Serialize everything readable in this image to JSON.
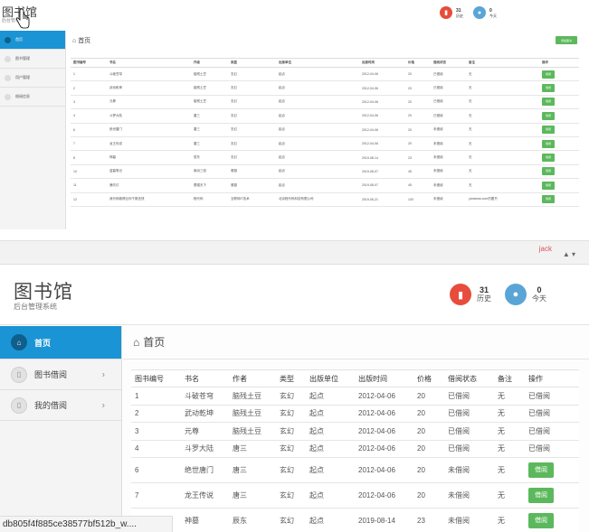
{
  "brand": {
    "title": "图书馆",
    "subtitle": "后台管理系统"
  },
  "user": {
    "name": "jack"
  },
  "stats": [
    {
      "num": "31",
      "label": "历史",
      "color": "#e74c3c"
    },
    {
      "num": "0",
      "label": "今天",
      "color": "#5aa5d6"
    }
  ],
  "top_sidebar": [
    {
      "label": "首页"
    },
    {
      "label": "图书管理"
    },
    {
      "label": "用户管理"
    },
    {
      "label": "借阅信息"
    }
  ],
  "bottom_sidebar": [
    {
      "label": "首页"
    },
    {
      "label": "图书借阅"
    },
    {
      "label": "我的借阅"
    }
  ],
  "page_heading": "首页",
  "add_book_label": "添加图书",
  "table": {
    "headers": [
      "图书编号",
      "书名",
      "作者",
      "类型",
      "出版单位",
      "出版时间",
      "价格",
      "借阅状态",
      "备注",
      "操作"
    ],
    "top_rows": [
      [
        "1",
        "斗破苍穹",
        "脑残土豆",
        "玄幻",
        "起点",
        "2012-04-06",
        "20",
        "已借阅",
        "无"
      ],
      [
        "2",
        "武动乾坤",
        "脑残土豆",
        "玄幻",
        "起点",
        "2012-04-06",
        "20",
        "已借阅",
        "无"
      ],
      [
        "3",
        "元尊",
        "脑残土豆",
        "玄幻",
        "起点",
        "2012-04-06",
        "20",
        "已借阅",
        "无"
      ],
      [
        "4",
        "斗罗大陆",
        "唐三",
        "玄幻",
        "起点",
        "2012-04-06",
        "20",
        "已借阅",
        "无"
      ],
      [
        "6",
        "绝世唐门",
        "唐三",
        "玄幻",
        "起点",
        "2012-04-06",
        "20",
        "未借阅",
        "无"
      ],
      [
        "7",
        "龙王传说",
        "唐三",
        "玄幻",
        "起点",
        "2012-04-06",
        "20",
        "未借阅",
        "无"
      ],
      [
        "8",
        "神墓",
        "辰东",
        "玄幻",
        "起点",
        "2019-08-14",
        "23",
        "未借阅",
        "无"
      ],
      [
        "10",
        "盗墓笔记",
        "南派三叔",
        "悬疑",
        "起点",
        "2019-08-07",
        "45",
        "未借阅",
        "无"
      ],
      [
        "11",
        "鬼吹灯",
        "蕾猫天下",
        "悬疑",
        "起点",
        "2019-08-07",
        "45",
        "未借阅",
        "无"
      ],
      [
        "12",
        "我代码跑得比你千数还快",
        "程代码",
        "互联网IT技术",
        "北京程代码科技有限公司",
        "2019-06-21",
        "100",
        "未借阅",
        "yardama.com的图书"
      ]
    ],
    "top_actions": [
      "借阅",
      "借阅",
      "借阅",
      "借阅",
      "借阅",
      "借阅",
      "借阅",
      "借阅",
      "借阅",
      "借阅"
    ],
    "bottom_rows": [
      [
        "1",
        "斗破苍穹",
        "脑残土豆",
        "玄幻",
        "起点",
        "2012-04-06",
        "20",
        "已借阅",
        "无",
        "已借阅"
      ],
      [
        "2",
        "武动乾坤",
        "脑残土豆",
        "玄幻",
        "起点",
        "2012-04-06",
        "20",
        "已借阅",
        "无",
        "已借阅"
      ],
      [
        "3",
        "元尊",
        "脑残土豆",
        "玄幻",
        "起点",
        "2012-04-06",
        "20",
        "已借阅",
        "无",
        "已借阅"
      ],
      [
        "4",
        "斗罗大陆",
        "唐三",
        "玄幻",
        "起点",
        "2012-04-06",
        "20",
        "已借阅",
        "无",
        "已借阅"
      ],
      [
        "6",
        "绝世唐门",
        "唐三",
        "玄幻",
        "起点",
        "2012-04-06",
        "20",
        "未借阅",
        "无",
        "借阅"
      ],
      [
        "7",
        "龙王传说",
        "唐三",
        "玄幻",
        "起点",
        "2012-04-06",
        "20",
        "未借阅",
        "无",
        "借阅"
      ],
      [
        "",
        "神墓",
        "辰东",
        "玄幻",
        "起点",
        "2019-08-14",
        "23",
        "未借阅",
        "无",
        "借阅"
      ]
    ]
  },
  "status_url": "db805f4f885ce38577bf512b_w...."
}
